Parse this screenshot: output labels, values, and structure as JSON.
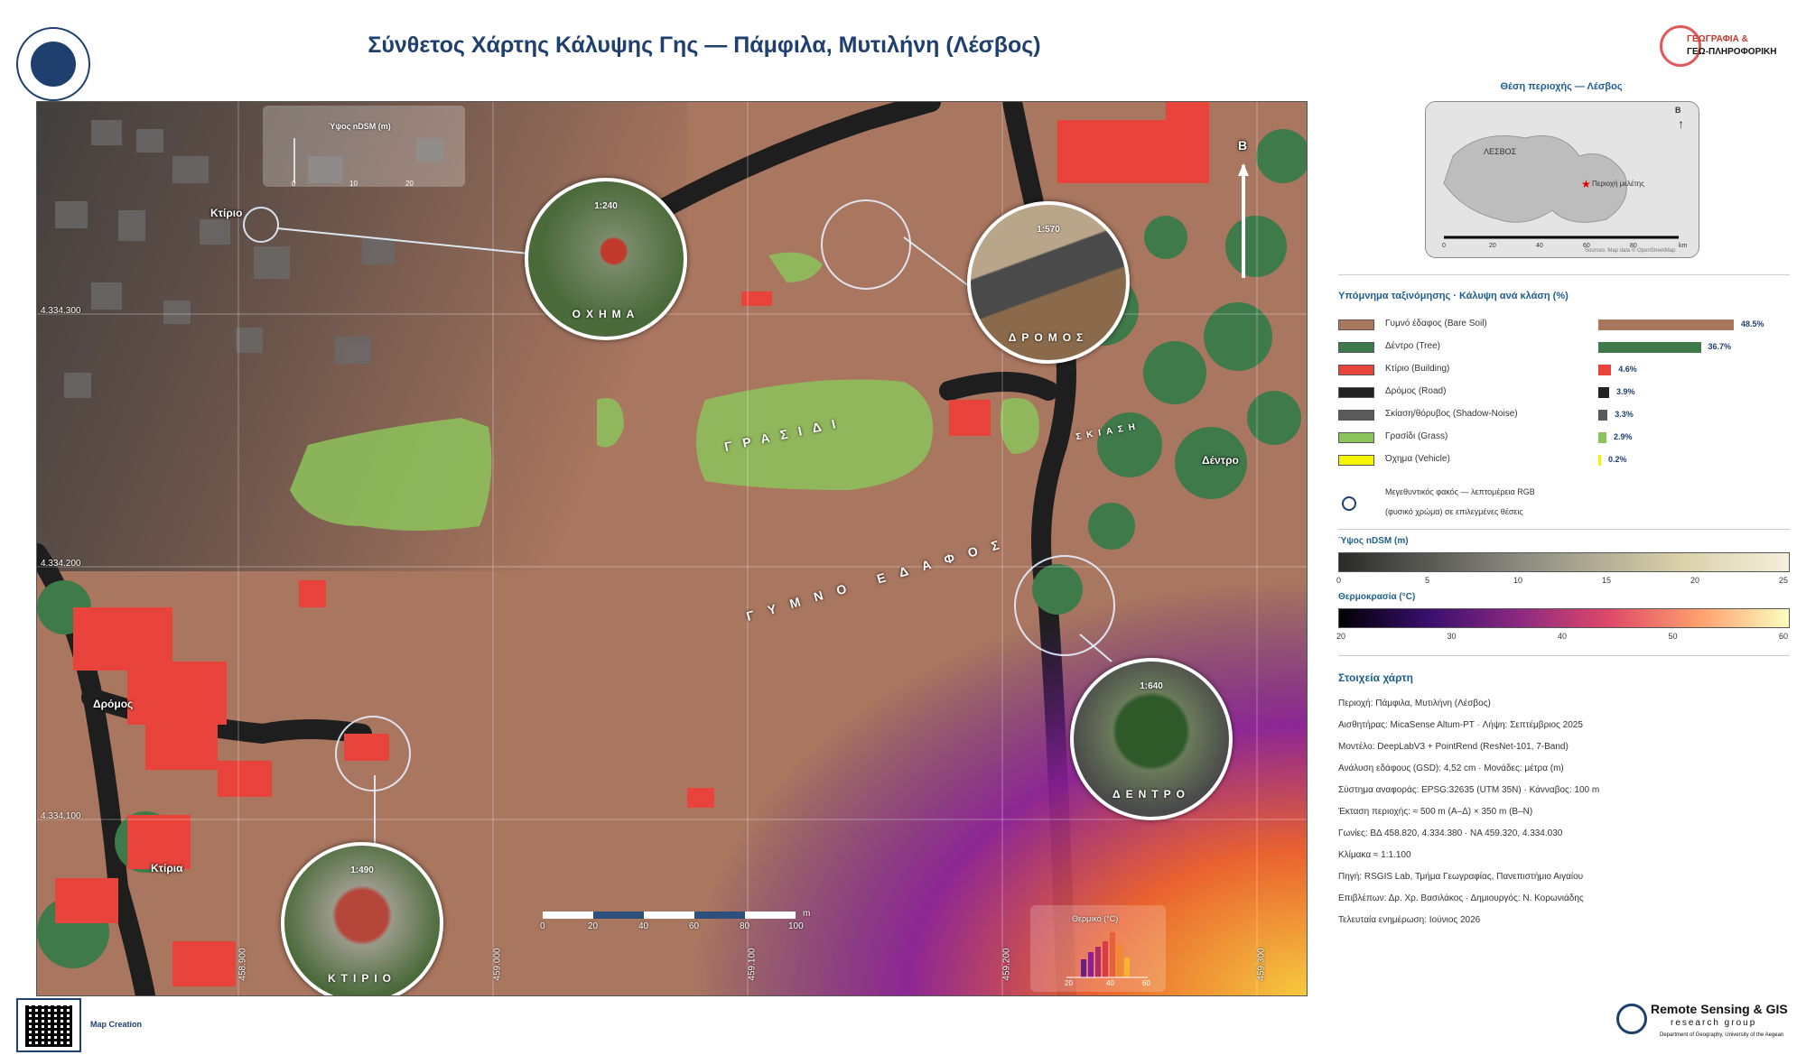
{
  "header": {
    "title": "Σύνθετος Χάρτης Κάλυψης Γης — Πάμφιλα, Μυτιλήνη (Λέσβος)",
    "logo_right_line1": "ΓΕΩΓΡΑΦΙΑ &",
    "logo_right_line2": "ΓΕΩ-ΠΛΗΡΟΦΟΡΙΚΗ"
  },
  "map": {
    "ndsm_inset": {
      "title": "Ύψος nDSM (m)",
      "ticks": [
        "0",
        "10",
        "20"
      ]
    },
    "labels": {
      "building_tl": "Κτίριο",
      "road": "Δρόμος",
      "buildings": "Κτίρια",
      "tree": "Δέντρο"
    },
    "curved_labels": {
      "grass": "ΓΡΑΣΙΔΙ",
      "bare": "ΓΥΜΝΟ ΕΔΑΦΟΣ",
      "shadow": "ΣΚΙΑΣΗ"
    },
    "lenses": [
      {
        "scale": "1:240",
        "caption": "ΟΧΗΜΑ"
      },
      {
        "scale": "1:570",
        "caption": "ΔΡΟΜΟΣ"
      },
      {
        "scale": "1:640",
        "caption": "ΔΕΝΤΡΟ"
      },
      {
        "scale": "1:490",
        "caption": "ΚΤΙΡΙΟ"
      }
    ],
    "north": "Β",
    "coords_y": [
      "4.334.300",
      "4.334.200",
      "4.334.100"
    ],
    "coords_x": [
      "458.900",
      "459.000",
      "459.100",
      "459.200",
      "459.300"
    ],
    "scalebar": {
      "ticks": [
        "0",
        "20",
        "40",
        "60",
        "80",
        "100"
      ],
      "unit": "m"
    },
    "thermal_hist": {
      "title": "Θερμικό (°C)",
      "ticks": [
        "20",
        "40",
        "60"
      ]
    }
  },
  "locator": {
    "title": "Θέση περιοχής — Λέσβος",
    "island_label": "ΛΕΣΒΟΣ",
    "study_label": "Περιοχή μελέτης",
    "north": "Β",
    "scale_ticks": [
      "0",
      "20",
      "40",
      "60",
      "80"
    ],
    "scale_unit": "km",
    "source": "Sources: Map data © OpenStreetMap"
  },
  "legend": {
    "title": "Υπόμνημα ταξινόμησης · Κάλυψη ανά κλάση (%)",
    "classes": [
      {
        "name": "Γυμνό έδαφος (Bare Soil)",
        "pct": "48.5%",
        "value": 48.5,
        "color": "#a9765f"
      },
      {
        "name": "Δέντρο (Tree)",
        "pct": "36.7%",
        "value": 36.7,
        "color": "#3f7a4a"
      },
      {
        "name": "Κτίριο (Building)",
        "pct": "4.6%",
        "value": 4.6,
        "color": "#e8443b"
      },
      {
        "name": "Δρόμος (Road)",
        "pct": "3.9%",
        "value": 3.9,
        "color": "#222222"
      },
      {
        "name": "Σκίαση/θόρυβος (Shadow-Noise)",
        "pct": "3.3%",
        "value": 3.3,
        "color": "#5a5a5a"
      },
      {
        "name": "Γρασίδι (Grass)",
        "pct": "2.9%",
        "value": 2.9,
        "color": "#8dc35c"
      },
      {
        "name": "Όχημα (Vehicle)",
        "pct": "0.2%",
        "value": 0.2,
        "color": "#f5f500"
      }
    ],
    "lens_note_line1": "Μεγεθυντικός φακός — λεπτομέρεια RGB",
    "lens_note_line2": "(φυσικό χρώμα) σε επιλεγμένες θέσεις"
  },
  "ndsm_ramp": {
    "title": "Ύψος nDSM (m)",
    "ticks": [
      "0",
      "5",
      "10",
      "15",
      "20",
      "25"
    ]
  },
  "temp_ramp": {
    "title": "Θερμοκρασία (°C)",
    "ticks": [
      "20",
      "30",
      "40",
      "50",
      "60"
    ]
  },
  "details": {
    "title": "Στοιχεία χάρτη",
    "lines": [
      "Περιοχή: Πάμφιλα, Μυτιλήνη (Λέσβος)",
      "Αισθητήρας: MicaSense Altum-PT  ·  Λήψη: Σεπτέμβριος 2025",
      "Μοντέλο: DeepLabV3 + PointRend (ResNet-101, 7-Band)",
      "Ανάλυση εδάφους (GSD): 4,52 cm  ·  Μονάδες: μέτρα (m)",
      "Σύστημα αναφοράς: EPSG:32635 (UTM 35N)  ·  Κάνναβος: 100 m",
      "Έκταση περιοχής: ≈ 500 m (Α–Δ) × 350 m (Β–Ν)",
      "Γωνίες: ΒΔ 458.820, 4.334.380  ·  ΝΑ 459.320, 4.334.030",
      "Κλίμακα ≈ 1:1.100",
      "Πηγή: RSGIS Lab, Τμήμα Γεωγραφίας, Πανεπιστήμιο Αιγαίου",
      "Επιβλέπων: Δρ. Χρ. Βασιλάκος  ·  Δημιουργός: Ν. Κορωνιάδης",
      "Τελευταία ενημέρωση: Ιούνιος 2026"
    ]
  },
  "footer": {
    "map_creation": "Map Creation",
    "rs_line1": "Remote Sensing & GIS",
    "rs_line2": "research group",
    "rs_line3": "Department of Geography, University of the Aegean"
  }
}
